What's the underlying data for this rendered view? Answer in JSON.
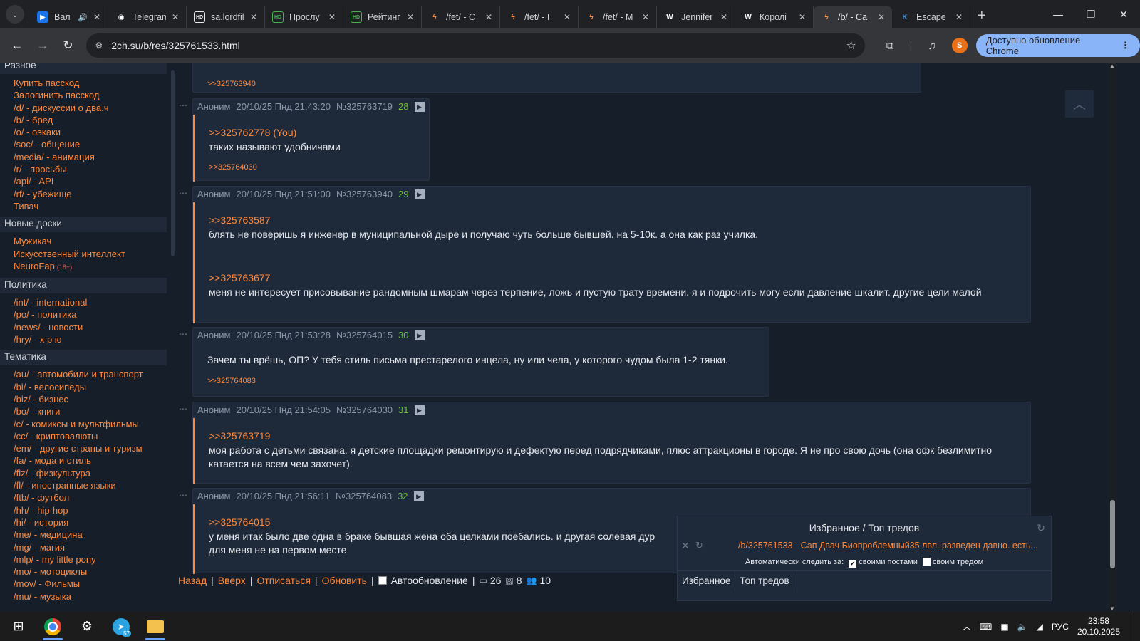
{
  "browser": {
    "tabs": [
      {
        "title": "Вал",
        "favicon": "youtube-icon",
        "favicon_color": "#ff0000",
        "sound": true
      },
      {
        "title": "Telegram",
        "favicon": "telegram-web-icon",
        "favicon_color": "#ffffff"
      },
      {
        "title": "sa.lordfilm",
        "favicon": "hd-icon",
        "favicon_color": "#e8eaed"
      },
      {
        "title": "Прослу",
        "favicon": "hd-green-icon",
        "favicon_color": "#4caf50"
      },
      {
        "title": "Рейтинг",
        "favicon": "hd-green-icon",
        "favicon_color": "#4caf50"
      },
      {
        "title": "/fet/ - С",
        "favicon": "2ch-bolt-icon",
        "favicon_color": "#ff8a3d"
      },
      {
        "title": "/fet/ - Г",
        "favicon": "2ch-bolt-icon",
        "favicon_color": "#ff8a3d"
      },
      {
        "title": "/fet/ - М",
        "favicon": "2ch-bolt-icon",
        "favicon_color": "#ff8a3d"
      },
      {
        "title": "Jennifer",
        "favicon": "wikipedia-icon",
        "favicon_color": "#ffffff"
      },
      {
        "title": "Королі",
        "favicon": "wikipedia-icon",
        "favicon_color": "#ffffff"
      },
      {
        "title": "/b/ - Са",
        "favicon": "2ch-bolt-icon",
        "favicon_color": "#ff8a3d",
        "active": true
      },
      {
        "title": "Escape",
        "favicon": "escape-icon",
        "favicon_color": "#4a90e2"
      }
    ],
    "url": "2ch.su/b/res/325761533.html",
    "update_button": "Доступно обновление Chrome",
    "profile_letter": "S"
  },
  "sidebar": {
    "groups": [
      {
        "title": "Разное",
        "links": [
          {
            "label": "Купить пасскод"
          },
          {
            "label": "Залогинить пасскод"
          },
          {
            "label": "/d/ - дискуссии о два.ч"
          },
          {
            "label": "/b/ - бред"
          },
          {
            "label": "/o/ - оэкаки"
          },
          {
            "label": "/soc/ - общение"
          },
          {
            "label": "/media/ - анимация"
          },
          {
            "label": "/r/ - просьбы"
          },
          {
            "label": "/api/ - API"
          },
          {
            "label": "/rf/ - убежище"
          },
          {
            "label": "Тивач"
          }
        ]
      },
      {
        "title": "Новые доски",
        "links": [
          {
            "label": "Мужикач"
          },
          {
            "label": "Искусственный интеллект"
          },
          {
            "label": "NeuroFap",
            "tag": "(18+)"
          }
        ]
      },
      {
        "title": "Политика",
        "links": [
          {
            "label": "/int/ - international"
          },
          {
            "label": "/po/ - политика"
          },
          {
            "label": "/news/ - новости"
          },
          {
            "label": "/hry/ - х р ю"
          }
        ]
      },
      {
        "title": "Тематика",
        "links": [
          {
            "label": "/au/ - автомобили и транспорт"
          },
          {
            "label": "/bi/ - велосипеды"
          },
          {
            "label": "/biz/ - бизнес"
          },
          {
            "label": "/bo/ - книги"
          },
          {
            "label": "/c/ - комиксы и мультфильмы"
          },
          {
            "label": "/cc/ - криптовалюты"
          },
          {
            "label": "/em/ - другие страны и туризм"
          },
          {
            "label": "/fa/ - мода и стиль"
          },
          {
            "label": "/fiz/ - физкультура"
          },
          {
            "label": "/fl/ - иностранные языки"
          },
          {
            "label": "/ftb/ - футбол"
          },
          {
            "label": "/hh/ - hip-hop"
          },
          {
            "label": "/hi/ - история"
          },
          {
            "label": "/me/ - медицина"
          },
          {
            "label": "/mg/ - магия"
          },
          {
            "label": "/mlp/ - my little pony"
          },
          {
            "label": "/mo/ - мотоциклы"
          },
          {
            "label": "/mov/ - Фильмы"
          },
          {
            "label": "/mu/ - музыка"
          }
        ]
      }
    ]
  },
  "posts": [
    {
      "reply_link": ">>325763940"
    },
    {
      "author": "Аноним",
      "date": "20/10/25 Пнд 21:43:20",
      "id": "№325763719",
      "index": "28",
      "paragraphs": [
        {
          "ref": ">>325762778 (You)",
          "text": "таких называют удобничами"
        }
      ],
      "replies": ">>325764030"
    },
    {
      "author": "Аноним",
      "date": "20/10/25 Пнд 21:51:00",
      "id": "№325763940",
      "index": "29",
      "paragraphs": [
        {
          "ref": ">>325763587",
          "text": "блять не поверишь я инженер в муниципальной дыре и получаю чуть больше бывшей. на 5-10к. а она как раз училка."
        },
        {
          "ref": ">>325763677",
          "text": "меня не интересует присовывание рандомным шмарам через терпение, ложь и пустую трату времени. я и подрочить могу если давление шкалит. другие цели малой"
        }
      ]
    },
    {
      "author": "Аноним",
      "date": "20/10/25 Пнд 21:53:28",
      "id": "№325764015",
      "index": "30",
      "paragraphs": [
        {
          "text": "Зачем ты врёшь, ОП? У тебя стиль письма престарелого инцела, ну или чела, у которого чудом была 1-2 тянки."
        }
      ],
      "replies": ">>325764083"
    },
    {
      "author": "Аноним",
      "date": "20/10/25 Пнд 21:54:05",
      "id": "№325764030",
      "index": "31",
      "paragraphs": [
        {
          "ref": ">>325763719",
          "text": "моя работа с детьми связана. я детские площадки ремонтирую и дефектую перед подрядчиками, плюс аттракционы в городе. Я не про свою дочь (она офк безлимитно катается на всем чем захочет)."
        }
      ]
    },
    {
      "author": "Аноним",
      "date": "20/10/25 Пнд 21:56:11",
      "id": "№325764083",
      "index": "32",
      "paragraphs": [
        {
          "ref": ">>325764015",
          "text": "у меня итак было две одна в браке бывшая жена оба целками поебались. и другая солевая дур",
          "text2": "для меня не на первом месте"
        }
      ]
    }
  ],
  "bottom_bar": {
    "back": "Назад",
    "top": "Вверх",
    "unsubscribe": "Отписаться",
    "refresh": "Обновить",
    "auto_update": "Автообновление",
    "stat_posts": "26",
    "stat_images": "8",
    "stat_users": "10"
  },
  "favorites_panel": {
    "title": "Избранное / Топ тредов",
    "thread_link": "/b/325761533 - Сап Двач Биопроблемный35 лвл. разведен давно. есть...",
    "auto_follow_label": "Автоматически следить за:",
    "own_posts": "своими постами",
    "own_thread": "своим тредом",
    "tab_favorites": "Избранное",
    "tab_top": "Топ тредов"
  },
  "taskbar": {
    "clock_time": "23:58",
    "clock_date": "20.10.2025",
    "language": "РУС",
    "telegram_badge": "57"
  },
  "colors": {
    "accent_link": "#ff8a3d",
    "post_bg": "#1e293a",
    "page_bg": "#161e2a",
    "post_number": "#6bbf3b"
  }
}
